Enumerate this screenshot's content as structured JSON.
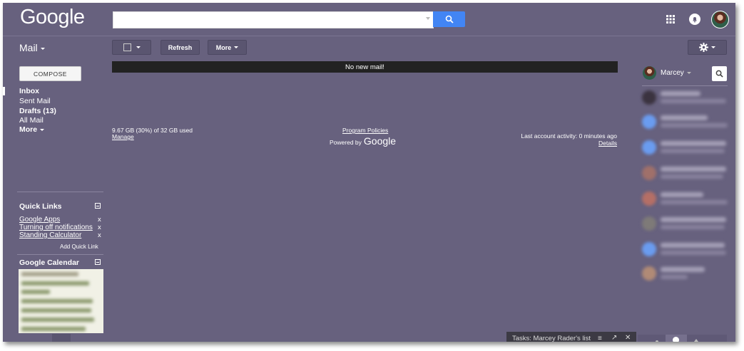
{
  "header": {
    "logo_text": "Google",
    "search_placeholder": "",
    "icons": [
      "search-icon",
      "apps-grid-icon",
      "notifications-icon",
      "avatar"
    ]
  },
  "toolbar": {
    "mail_label": "Mail",
    "refresh_label": "Refresh",
    "more_label": "More",
    "settings_icon": "gear-icon"
  },
  "sidebar": {
    "compose_label": "COMPOSE",
    "items": [
      {
        "label": "Inbox",
        "bold": true
      },
      {
        "label": "Sent Mail",
        "bold": false
      },
      {
        "label": "Drafts (13)",
        "bold": true
      },
      {
        "label": "All Mail",
        "bold": false
      },
      {
        "label": "More",
        "bold": true
      }
    ],
    "quick_links": {
      "title": "Quick Links",
      "links": [
        "Google Apps",
        "Turning off notifications",
        "Standing Calculator"
      ],
      "remove_label": "x",
      "add_label": "Add Quick Link"
    },
    "calendar": {
      "title": "Google Calendar"
    }
  },
  "main": {
    "banner": "No new mail!",
    "storage": "9.67 GB (30%) of 32 GB used",
    "manage_label": "Manage",
    "program_policies": "Program Policies",
    "powered_by": "Powered by",
    "powered_logo": "Google",
    "last_activity": "Last account activity: 0 minutes ago",
    "details_label": "Details"
  },
  "chat": {
    "user_name": "Marcey"
  },
  "tasks": {
    "title": "Tasks: Marcey Rader's list",
    "icons": [
      "menu-icon",
      "popout-icon",
      "close-icon"
    ]
  },
  "colors": {
    "theme_bg": "#67617e",
    "search_blue": "#4285f4",
    "banner_bg": "#222222"
  }
}
